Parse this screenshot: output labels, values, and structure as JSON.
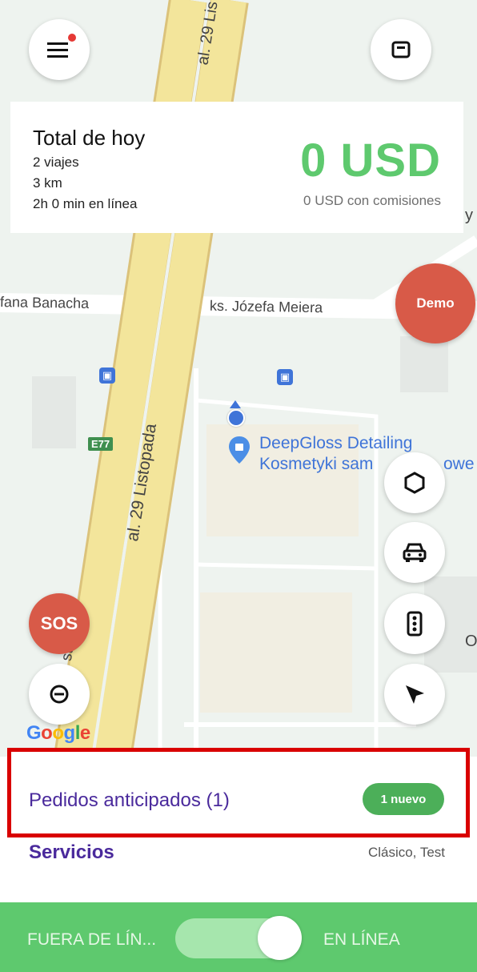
{
  "map": {
    "street_main": "al. 29 Listopada",
    "street_main_top": "al. 29 Lis",
    "street_main_lower": "ste",
    "street_cross_left": "fana Banacha",
    "street_cross_right": "ks. Józefa Meiera",
    "route_badge": "E77",
    "poi_name_line1": "DeepGloss Detailing",
    "poi_name_line2": "Kosmetyki sam",
    "poi_name_tail": "owe",
    "edge_letter_y": "y",
    "edge_letter_o": "O",
    "google_logo": "Google"
  },
  "summary": {
    "title": "Total de hoy",
    "trips": "2 viajes",
    "distance": "3 km",
    "online_time": "2h 0 min en línea",
    "total": "0 USD",
    "with_commission": "0 USD con comisiones"
  },
  "buttons": {
    "demo": "Demo",
    "sos": "SOS"
  },
  "panel": {
    "preorders_label": "Pedidos anticipados (1)",
    "preorders_badge": "1 nuevo",
    "services_label": "Servicios",
    "services_value": "Clásico, Test"
  },
  "status_bar": {
    "offline": "FUERA DE LÍN...",
    "online": "EN LÍNEA",
    "toggle_on": true
  },
  "colors": {
    "accent_green": "#5ec96e",
    "alert_red": "#d85a48",
    "purple_text": "#4a2a9c",
    "highlight_border": "#d90000"
  }
}
